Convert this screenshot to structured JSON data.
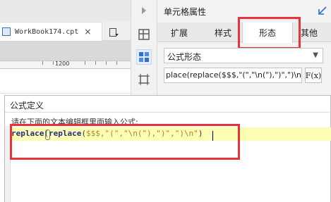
{
  "document": {
    "tab_name": "WorkBook174.cpt",
    "close_symbol": "×",
    "ruler_label": "1200"
  },
  "panel": {
    "title": "单元格属性",
    "tabs": [
      {
        "label": "扩展"
      },
      {
        "label": "样式"
      },
      {
        "label": "形态"
      },
      {
        "label": "其他"
      }
    ],
    "selected_tab": "形态",
    "form_select": {
      "value": "公式形态"
    },
    "formula_value": "place(replace($$$,\"(\",\"\\n(\"),\")\",\")\\n\")",
    "fx_label": "F(x)"
  },
  "dialog": {
    "title": "公式定义",
    "hint": "请在下面的文本编辑框里面输入公式:",
    "code": {
      "fn1": "replace",
      "p1": "(",
      "fn2": "replace",
      "p2": "(",
      "arg1": "$$$,\"(\",\"\\n(\"),\")\",\")\\n\"",
      "p3": ")"
    }
  },
  "colors": {
    "highlight": "#e8323c",
    "accent": "#2d6ed6",
    "editor_line": "#fdfdb4",
    "keyword": "#1c2f8a",
    "string": "#a5892f"
  }
}
